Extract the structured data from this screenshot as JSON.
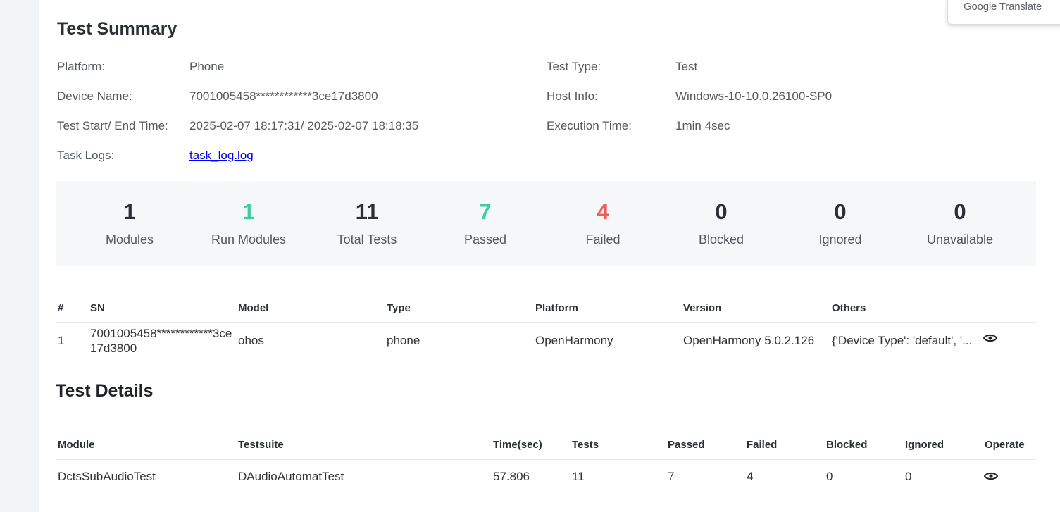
{
  "translate_widget": {
    "label": "Google Translate"
  },
  "summary": {
    "title": "Test Summary",
    "fields": [
      {
        "label": "Platform:",
        "value": "Phone"
      },
      {
        "label": "Device Name:",
        "value": "7001005458************3ce17d3800"
      },
      {
        "label": "Test Start/ End Time:",
        "value": "2025-02-07 18:17:31/ 2025-02-07 18:18:35"
      },
      {
        "label": "Task Logs:",
        "value": "task_log.log"
      },
      {
        "label": "Test Type:",
        "value": "Test"
      },
      {
        "label": "Host Info:",
        "value": "Windows-10-10.0.26100-SP0"
      },
      {
        "label": "Execution Time:",
        "value": "1min 4sec"
      }
    ]
  },
  "stats": [
    {
      "value": "1",
      "label": "Modules"
    },
    {
      "value": "1",
      "label": "Run Modules",
      "color": "#3ccf9c"
    },
    {
      "value": "11",
      "label": "Total Tests"
    },
    {
      "value": "7",
      "label": "Passed",
      "color": "#3ccf9c"
    },
    {
      "value": "4",
      "label": "Failed",
      "color": "#ef5c5c"
    },
    {
      "value": "0",
      "label": "Blocked"
    },
    {
      "value": "0",
      "label": "Ignored"
    },
    {
      "value": "0",
      "label": "Unavailable"
    }
  ],
  "devices": {
    "headers": [
      "#",
      "SN",
      "Model",
      "Type",
      "Platform",
      "Version",
      "Others"
    ],
    "rows": [
      [
        "1",
        "7001005458************3ce17d3800",
        "ohos",
        "phone",
        "OpenHarmony",
        "OpenHarmony 5.0.2.126",
        "{'Device Type': 'default', '..."
      ]
    ]
  },
  "details": {
    "title": "Test Details",
    "headers": [
      "Module",
      "Testsuite",
      "Time(sec)",
      "Tests",
      "Passed",
      "Failed",
      "Blocked",
      "Ignored",
      "Operate"
    ],
    "rows": [
      [
        "DctsSubAudioTest",
        "DAudioAutomatTest",
        "57.806",
        "11",
        "7",
        "4",
        "0",
        "0"
      ]
    ]
  },
  "icons": {
    "view": "eye-icon"
  }
}
